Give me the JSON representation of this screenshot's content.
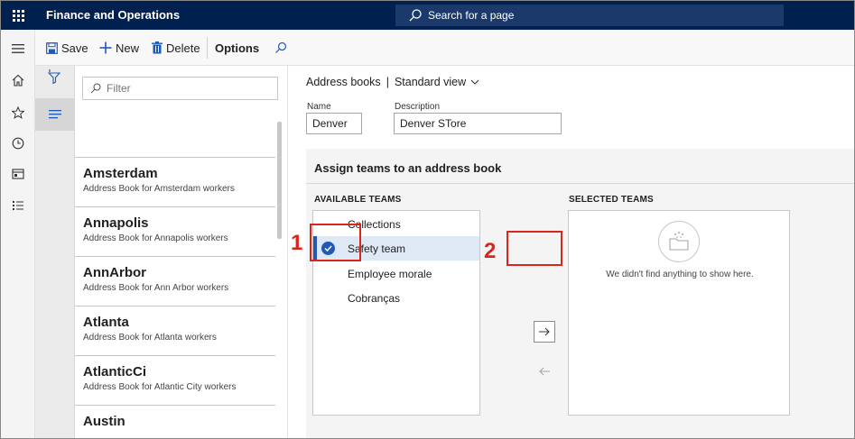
{
  "app": {
    "title": "Finance and Operations",
    "search_placeholder": "Search for a page"
  },
  "nav_rail": {
    "icons": [
      "hamburger-icon",
      "home-icon",
      "star-icon",
      "clock-icon",
      "workspace-icon",
      "modules-icon"
    ]
  },
  "actionbar": {
    "save_label": "Save",
    "new_label": "New",
    "delete_label": "Delete",
    "options_label": "Options"
  },
  "list": {
    "filter_placeholder": "Filter",
    "items": [
      {
        "name": "Amsterdam",
        "description": "Address Book for Amsterdam workers"
      },
      {
        "name": "Annapolis",
        "description": "Address Book for Annapolis workers"
      },
      {
        "name": "AnnArbor",
        "description": "Address Book for Ann Arbor workers"
      },
      {
        "name": "Atlanta",
        "description": "Address Book for Atlanta workers"
      },
      {
        "name": "AtlanticCi",
        "description": "Address Book for Atlantic City workers"
      },
      {
        "name": "Austin",
        "description": ""
      }
    ]
  },
  "detail": {
    "breadcrumb_page": "Address books",
    "breadcrumb_sep": "|",
    "view_name": "Standard view",
    "name_label": "Name",
    "name_value": "Denver",
    "description_label": "Description",
    "description_value": "Denver STore"
  },
  "assign": {
    "title": "Assign teams to an address book",
    "available_header": "AVAILABLE TEAMS",
    "selected_header": "SELECTED TEAMS",
    "available_teams": [
      {
        "name": "Collections",
        "selected": false
      },
      {
        "name": "Safety team",
        "selected": true
      },
      {
        "name": "Employee morale",
        "selected": false
      },
      {
        "name": "Cobranças",
        "selected": false
      }
    ],
    "empty_message": "We didn't find anything to show here."
  },
  "annotations": {
    "step1": "1",
    "step2": "2",
    "color": "#d9261c"
  },
  "colors": {
    "topbar": "#002050",
    "accent": "#1f5ab5",
    "selected_row": "#dfe9f5"
  }
}
